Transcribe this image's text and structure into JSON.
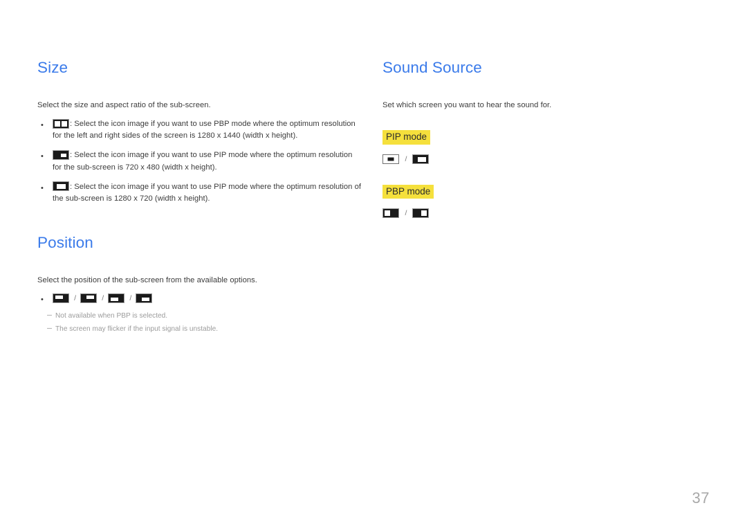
{
  "page": {
    "number": "37"
  },
  "left_column": {
    "size_section": {
      "title": "Size",
      "intro": "Select the size and aspect ratio of the sub-screen.",
      "bullets": [
        {
          "icon": "pbp-split-screen-icon",
          "text": ": Select the icon image if you want to use PBP mode where the optimum resolution for the left and right sides of the screen is 1280 x 1440 (width x height)."
        },
        {
          "icon": "pip-small-subscreen-icon",
          "text": ": Select the icon image if you want to use PIP mode where the optimum resolution for the sub-screen is 720 x 480 (width x height)."
        },
        {
          "icon": "pip-large-subscreen-icon",
          "text": ": Select the icon image if you want to use PIP mode where the optimum resolution of the sub-screen is 1280 x 720 (width x height)."
        }
      ]
    },
    "position_section": {
      "title": "Position",
      "intro": "Select the position of the sub-screen from the available options.",
      "icons": [
        "position-top-left-icon",
        "position-top-right-icon",
        "position-bottom-left-icon",
        "position-bottom-right-icon"
      ],
      "separator": "/",
      "notes": [
        "Not available when PBP is selected.",
        "The screen may flicker if the input signal is unstable."
      ]
    }
  },
  "right_column": {
    "sound_source_section": {
      "title": "Sound Source",
      "intro": "Set which screen you want to hear the sound for.",
      "separator": "/",
      "modes": [
        {
          "label": "PIP mode",
          "icons": [
            "sound-source-pip-main-icon",
            "sound-source-pip-sub-icon"
          ]
        },
        {
          "label": "PBP mode",
          "icons": [
            "sound-source-pbp-left-icon",
            "sound-source-pbp-right-icon"
          ]
        }
      ]
    }
  },
  "colors": {
    "heading": "#3b7bea",
    "highlight": "#f5e03c",
    "body_text": "#3b3b3b",
    "note_text": "#9b9b9b",
    "page_number": "#a8a8a8"
  }
}
